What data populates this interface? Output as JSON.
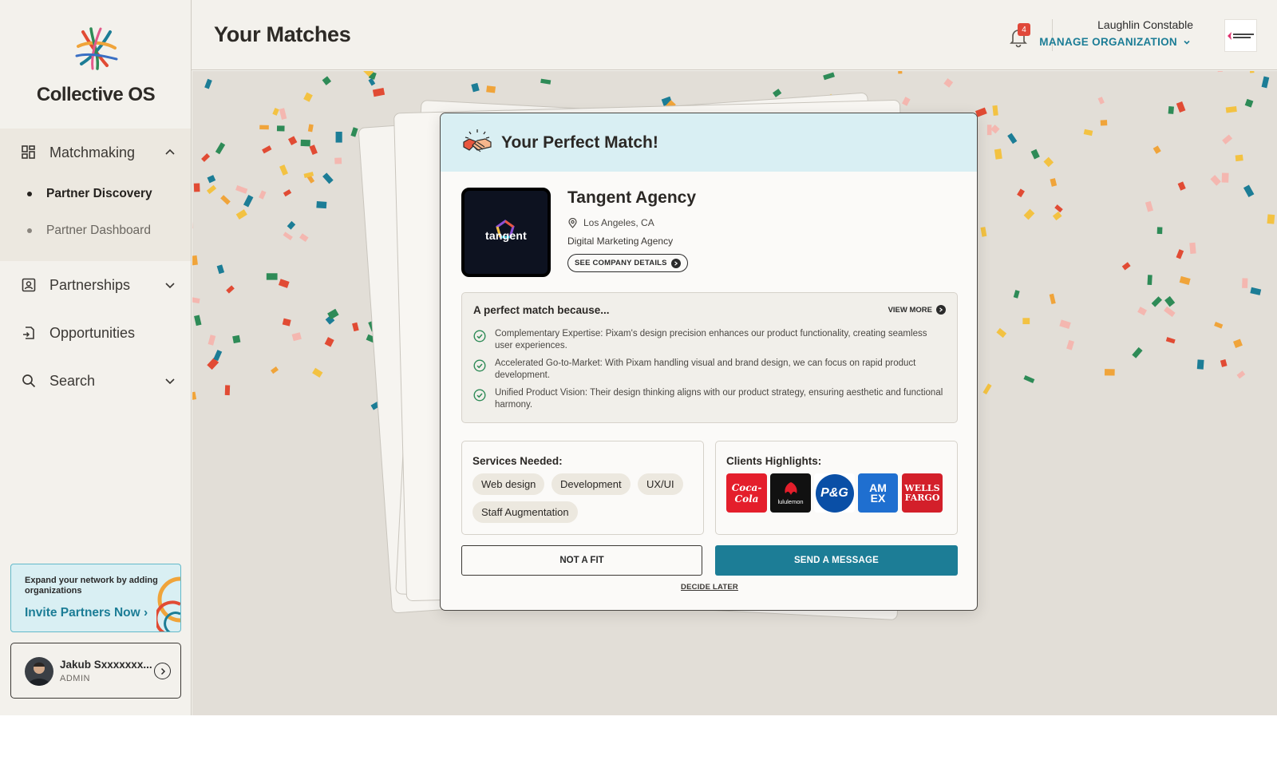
{
  "brand": {
    "name": "Collective OS"
  },
  "sidebar": {
    "sections": [
      {
        "label": "Matchmaking",
        "icon": "grid-icon",
        "expanded": true
      },
      {
        "label": "Partnerships",
        "icon": "id-card-icon",
        "expanded": false
      },
      {
        "label": "Opportunities",
        "icon": "export-doc-icon"
      },
      {
        "label": "Search",
        "icon": "search-icon",
        "expanded": false
      }
    ],
    "subitems": [
      {
        "label": "Partner Discovery",
        "active": true
      },
      {
        "label": "Partner Dashboard",
        "active": false
      }
    ],
    "invite": {
      "text": "Expand your network by adding organizations",
      "link": "Invite Partners Now"
    },
    "user": {
      "name": "Jakub Sxxxxxxx...",
      "role": "ADMIN"
    }
  },
  "header": {
    "title": "Your Matches",
    "notifications_count": "4",
    "org_user": "Laughlin Constable",
    "manage_label": "MANAGE ORGANIZATION"
  },
  "match": {
    "heading": "Your Perfect Match!",
    "agency": {
      "name": "Tangent Agency",
      "location": "Los Angeles, CA",
      "type": "Digital Marketing Agency",
      "logo_text": "tangent",
      "details_label": "SEE COMPANY DETAILS"
    },
    "why": {
      "title": "A perfect match because...",
      "view_more": "VIEW MORE",
      "reasons": [
        "Complementary Expertise: Pixam's design precision enhances our product functionality, creating seamless user experiences.",
        "Accelerated Go-to-Market: With Pixam handling visual and brand design, we can focus on rapid product development.",
        "Unified Product Vision: Their design thinking aligns with our product strategy, ensuring aesthetic and functional harmony."
      ]
    },
    "services": {
      "title": "Services Needed:",
      "items": [
        "Web design",
        "Development",
        "UX/UI",
        "Staff Augmentation"
      ]
    },
    "clients": {
      "title": "Clients Highlights:",
      "items": [
        {
          "name": "Coca-Cola",
          "color": "#e41e2b"
        },
        {
          "name": "lululemon",
          "color": "#111111"
        },
        {
          "name": "P&G",
          "color": "#0a4fa6"
        },
        {
          "name": "AM EX",
          "color": "#1f6fd0"
        },
        {
          "name": "WELLS FARGO",
          "color": "#d31f2a"
        }
      ]
    },
    "actions": {
      "not_fit": "NOT A FIT",
      "send": "SEND A MESSAGE",
      "later": "DECIDE LATER"
    }
  },
  "colors": {
    "accent": "#1c7d96",
    "header_tint": "#d9eff3",
    "badge": "#e0483a"
  }
}
